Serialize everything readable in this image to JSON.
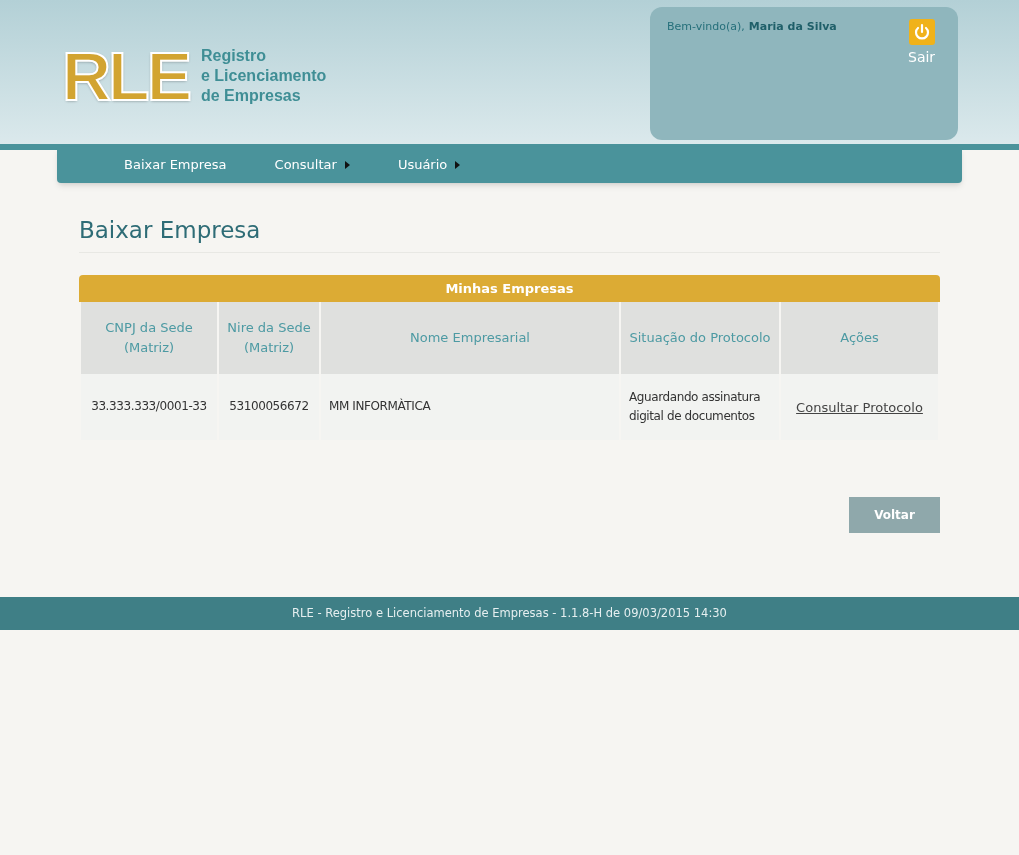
{
  "header": {
    "logo": "RLE",
    "logo_subtitle": [
      "Registro",
      "e Licenciamento",
      "de Empresas"
    ],
    "welcome": "Bem-vindo(a),",
    "user_name": "Maria da Silva",
    "logout": "Sair"
  },
  "nav": [
    {
      "label": "Baixar Empresa",
      "has_menu": false
    },
    {
      "label": "Consultar",
      "has_menu": true
    },
    {
      "label": "Usuário",
      "has_menu": true
    }
  ],
  "page_title": "Baixar Empresa",
  "table": {
    "title": "Minhas Empresas",
    "columns": [
      "CNPJ da Sede (Matriz)",
      "Nire da Sede (Matriz)",
      "Nome Empresarial",
      "Situação do Protocolo",
      "Ações"
    ],
    "rows": [
      {
        "cells": [
          "33.333.333/0001-33",
          "53100056672",
          "MM INFORMÀTICA",
          "Aguardando assinatura digital de documentos"
        ],
        "action": "Consultar Protocolo"
      }
    ]
  },
  "back_button": "Voltar",
  "footer": "RLE - Registro e Licenciamento de Empresas - 1.1.8-H de 09/03/2015 14:30"
}
